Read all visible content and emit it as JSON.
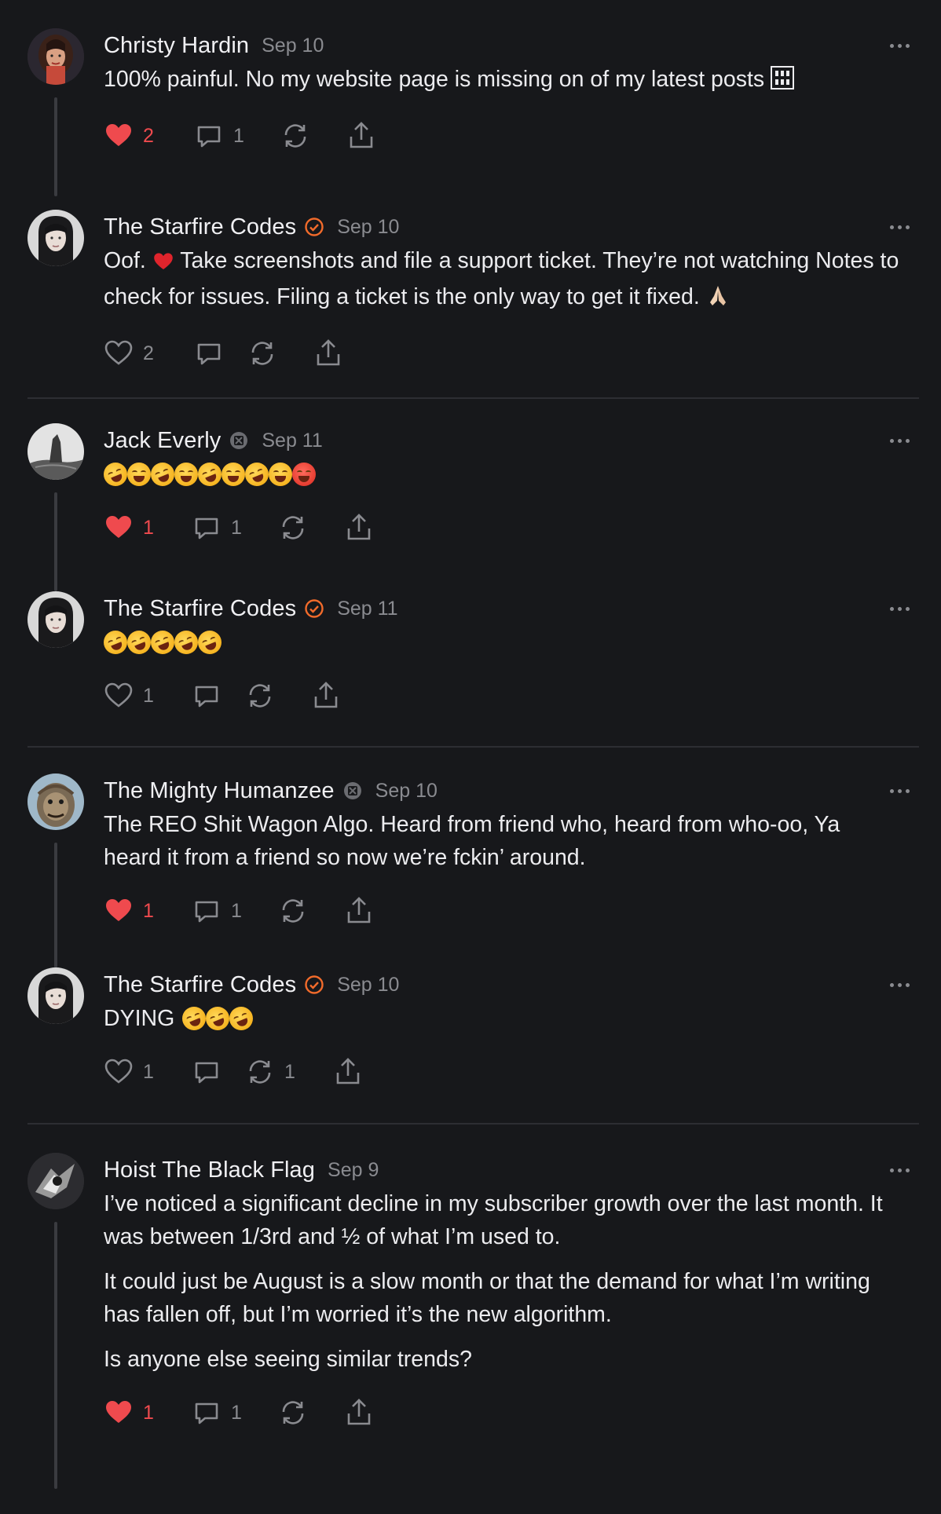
{
  "colors": {
    "background": "#17181b",
    "like_red": "#ef4a4e",
    "verified_orange": "#f26b2b",
    "muted": "#8a8b90",
    "text": "#ececef"
  },
  "icons": {
    "like": "heart-icon",
    "reply": "speech-bubble-icon",
    "restack": "restack-arrows-icon",
    "share": "share-upload-icon",
    "more": "ellipsis-icon"
  },
  "posts": [
    {
      "author": "Christy Hardin",
      "date": "Sep 10",
      "body": [
        "100% painful. No my website page is missing on of my latest posts"
      ],
      "likes": "2",
      "liked": true,
      "replies": "1",
      "restacks": ""
    },
    {
      "author": "The Starfire Codes",
      "date": "Sep 10",
      "body": [
        "Oof.",
        "Take screenshots and file a support ticket. They’re not watching Notes to check for issues. Filing a ticket is the only way to get it fixed."
      ],
      "likes": "2",
      "liked": false,
      "replies": "",
      "restacks": ""
    },
    {
      "author": "Jack Everly",
      "date": "Sep 11",
      "likes": "1",
      "liked": true,
      "replies": "1",
      "restacks": ""
    },
    {
      "author": "The Starfire Codes",
      "date": "Sep 11",
      "likes": "1",
      "liked": false,
      "replies": "",
      "restacks": ""
    },
    {
      "author": "The Mighty Humanzee",
      "date": "Sep 10",
      "body": [
        "The REO Shit Wagon Algo. Heard from friend who, heard from who-oo, Ya heard it from a friend so now we’re fckin’ around."
      ],
      "likes": "1",
      "liked": true,
      "replies": "1",
      "restacks": ""
    },
    {
      "author": "The Starfire Codes",
      "date": "Sep 10",
      "body": [
        "DYING"
      ],
      "likes": "1",
      "liked": false,
      "replies": "",
      "restacks": "1"
    },
    {
      "author": "Hoist The Black Flag",
      "date": "Sep 9",
      "body": [
        "I’ve noticed a significant decline in my subscriber growth over the last month. It was between 1/3rd and ½ of what I’m used to.",
        "It could just be August is a slow month or that the demand for what I’m writing has fallen off, but I’m worried it’s the new algorithm.",
        "Is anyone else seeing similar trends?"
      ],
      "likes": "1",
      "liked": true,
      "replies": "1",
      "restacks": ""
    }
  ]
}
